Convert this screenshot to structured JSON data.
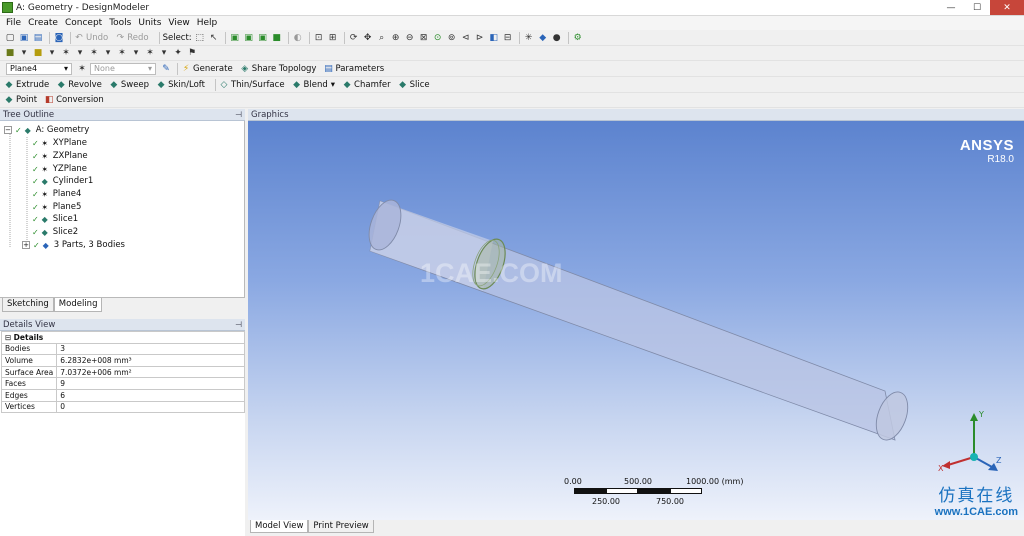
{
  "window": {
    "title": "A: Geometry - DesignModeler"
  },
  "menu": [
    "File",
    "Create",
    "Concept",
    "Tools",
    "Units",
    "View",
    "Help"
  ],
  "toolbar1": {
    "undo": "Undo",
    "redo": "Redo",
    "select_label": "Select:"
  },
  "toolbar3": {
    "plane_value": "Plane4",
    "sketch_value": "None",
    "generate": "Generate",
    "share_topology": "Share Topology",
    "parameters": "Parameters"
  },
  "toolbar4": {
    "extrude": "Extrude",
    "revolve": "Revolve",
    "sweep": "Sweep",
    "skin_loft": "Skin/Loft",
    "thin_surface": "Thin/Surface",
    "blend": "Blend",
    "chamfer": "Chamfer",
    "slice": "Slice"
  },
  "toolbar5": {
    "point": "Point",
    "conversion": "Conversion"
  },
  "tree": {
    "header": "Tree Outline",
    "root": "A: Geometry",
    "items": [
      {
        "label": "XYPlane",
        "icon": "plane-icon"
      },
      {
        "label": "ZXPlane",
        "icon": "plane-icon"
      },
      {
        "label": "YZPlane",
        "icon": "plane-icon"
      },
      {
        "label": "Cylinder1",
        "icon": "cylinder-icon"
      },
      {
        "label": "Plane4",
        "icon": "plane-icon"
      },
      {
        "label": "Plane5",
        "icon": "plane-icon"
      },
      {
        "label": "Slice1",
        "icon": "slice-icon"
      },
      {
        "label": "Slice2",
        "icon": "slice-icon"
      },
      {
        "label": "3 Parts, 3 Bodies",
        "icon": "parts-icon"
      }
    ]
  },
  "tabs": {
    "sketching": "Sketching",
    "modeling": "Modeling"
  },
  "details": {
    "header": "Details View",
    "section": "Details",
    "rows": [
      {
        "key": "Bodies",
        "value": "3"
      },
      {
        "key": "Volume",
        "value": "6.2832e+008 mm³"
      },
      {
        "key": "Surface Area",
        "value": "7.0372e+006 mm²"
      },
      {
        "key": "Faces",
        "value": "9"
      },
      {
        "key": "Edges",
        "value": "6"
      },
      {
        "key": "Vertices",
        "value": "0"
      }
    ]
  },
  "graphics": {
    "header": "Graphics",
    "brand": "ANSYS",
    "version": "R18.0",
    "watermark": "1CAE.COM",
    "scale_top": [
      "0.00",
      "500.00",
      "1000.00 (mm)"
    ],
    "scale_bottom": [
      "250.00",
      "750.00"
    ],
    "axes": {
      "y": "Y",
      "x": "X",
      "z": "Z"
    },
    "corner_cn": "仿真在线",
    "corner_url": "www.1CAE.com"
  },
  "bottom_tabs": {
    "model_view": "Model View",
    "print_preview": "Print Preview"
  },
  "colors": {
    "accent": "#2b8c2b",
    "viewport_top": "#5c83cf",
    "viewport_bottom": "#eef2fb"
  }
}
